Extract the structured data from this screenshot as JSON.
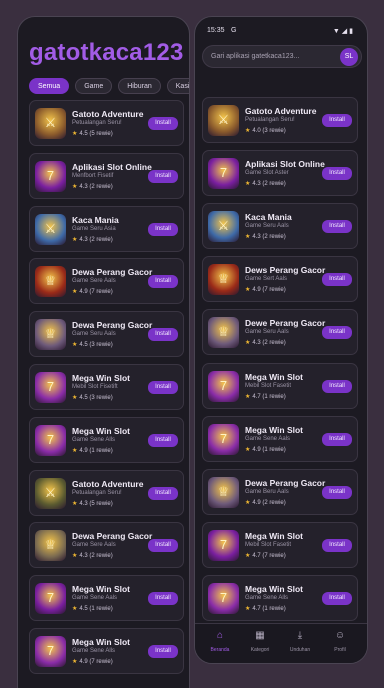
{
  "left": {
    "brand": "gatotkaca123",
    "chips": [
      "Semua",
      "Game",
      "Hiburan",
      "Kasino"
    ],
    "active_chip": 0,
    "install_label": "Install",
    "apps": [
      {
        "title": "Gatoto Adventure",
        "subtitle": "Petualangan Seru!",
        "rating": "4.5",
        "reviews": "(5 rewie)",
        "icon": "warrior-icon",
        "color": "#8a5a2c"
      },
      {
        "title": "Aplikasi Slot Online",
        "subtitle": "Menfbort Fisetif",
        "rating": "4.3",
        "reviews": "(2 rewie)",
        "icon": "777-slot-icon",
        "color": "#7a1fa0"
      },
      {
        "title": "Kaca Mania",
        "subtitle": "Game Seru Asia",
        "rating": "4.3",
        "reviews": "(2 rewie)",
        "icon": "warrior-icon",
        "color": "#3e6aa8"
      },
      {
        "title": "Dewa Perang Gacor",
        "subtitle": "Game Sere Aals",
        "rating": "4.9",
        "reviews": "(7 rewie)",
        "icon": "god-icon",
        "color": "#9a2a18"
      },
      {
        "title": "Dewa Perang Gacor",
        "subtitle": "Game Seru Aals",
        "rating": "4.5",
        "reviews": "(3 rewie)",
        "icon": "god-icon",
        "color": "#6e5a7a"
      },
      {
        "title": "Mega Win Slot",
        "subtitle": "Mebil Slot Fisetift",
        "rating": "4.5",
        "reviews": "(3 rewie)",
        "icon": "777-slot-icon",
        "color": "#8a2ca8"
      },
      {
        "title": "Mega Win Slot",
        "subtitle": "Game Sene Alls",
        "rating": "4.9",
        "reviews": "(1 rewie)",
        "icon": "777-slot-icon",
        "color": "#8a2ca8"
      },
      {
        "title": "Gatoto Adventure",
        "subtitle": "Petualangan Seru!",
        "rating": "4.3",
        "reviews": "(5 rewie)",
        "icon": "warrior-icon",
        "color": "#5a5a30"
      },
      {
        "title": "Dewa Perang Gacor",
        "subtitle": "Game Sere Aals",
        "rating": "4.3",
        "reviews": "(2 rewie)",
        "icon": "god-icon",
        "color": "#7a6a50"
      },
      {
        "title": "Mega Win Slot",
        "subtitle": "Game Sene Aals",
        "rating": "4.5",
        "reviews": "(1 rewie)",
        "icon": "777-slot-icon",
        "color": "#7a1fa0"
      },
      {
        "title": "Mega Win Slot",
        "subtitle": "Game Sene Alls",
        "rating": "4.9",
        "reviews": "(7 rewie)",
        "icon": "777-slot-icon",
        "color": "#8a2ca8"
      }
    ]
  },
  "right": {
    "status_time": "15:35",
    "status_badge": "G",
    "status_icons": "▼◢▮",
    "search_placeholder": "Gari aplikasi gatetkaca123...",
    "avatar_initials": "SL",
    "install_label": "Install",
    "apps": [
      {
        "title": "Gatoto Adventure",
        "subtitle": "Petualangan Seru!",
        "rating": "4.0",
        "reviews": "(3 rewie)",
        "icon": "warrior-icon",
        "color": "#8a5a2c"
      },
      {
        "title": "Aplikasi Slot Online",
        "subtitle": "Game Slot Aster",
        "rating": "4.3",
        "reviews": "(2 rewie)",
        "icon": "777-slot-icon",
        "color": "#7a1fa0"
      },
      {
        "title": "Kaca Mania",
        "subtitle": "Game Seru Aals",
        "rating": "4.3",
        "reviews": "(2 rewie)",
        "icon": "warrior-icon",
        "color": "#3e6aa8"
      },
      {
        "title": "Dews Perang Gacor",
        "subtitle": "Game Sert Aals",
        "rating": "4.9",
        "reviews": "(7 rewie)",
        "icon": "god-icon",
        "color": "#9a2a18"
      },
      {
        "title": "Dewe Perang Gacor",
        "subtitle": "Game Seru Aals",
        "rating": "4.3",
        "reviews": "(2 rewie)",
        "icon": "god-icon",
        "color": "#6e5a7a"
      },
      {
        "title": "Mega Win Slot",
        "subtitle": "Mebil Slot Fasetit",
        "rating": "4.7",
        "reviews": "(1 rewie)",
        "icon": "777-slot-icon",
        "color": "#8a2ca8"
      },
      {
        "title": "Mega Win Slot",
        "subtitle": "Game Sene Aals",
        "rating": "4.9",
        "reviews": "(1 rewie)",
        "icon": "777-slot-icon",
        "color": "#8a2ca8"
      },
      {
        "title": "Dewa Perang Gacor",
        "subtitle": "Game Beru Aals",
        "rating": "4.9",
        "reviews": "(2 rewie)",
        "icon": "god-icon",
        "color": "#6e5a7a"
      },
      {
        "title": "Mega Win Slot",
        "subtitle": "Mebil Slot Fasetit",
        "rating": "4.7",
        "reviews": "(7 rewie)",
        "icon": "777-slot-icon",
        "color": "#7a1fa0"
      },
      {
        "title": "Mega Win Slot",
        "subtitle": "Game Sene Alls",
        "rating": "4.7",
        "reviews": "(1 rewie)",
        "icon": "777-slot-icon",
        "color": "#8a2ca8"
      }
    ],
    "tabs": [
      {
        "label": "Beranda",
        "icon": "home-icon",
        "active": true
      },
      {
        "label": "Kategori",
        "icon": "grid-icon",
        "active": false
      },
      {
        "label": "Unduhan",
        "icon": "download-icon",
        "active": false
      },
      {
        "label": "Profil",
        "icon": "person-icon",
        "active": false
      }
    ]
  },
  "colors": {
    "accent": "#7a33c8",
    "brand": "#a25ce6",
    "background": "#1c1a22",
    "card": "#24212b",
    "star": "#f0b832"
  }
}
